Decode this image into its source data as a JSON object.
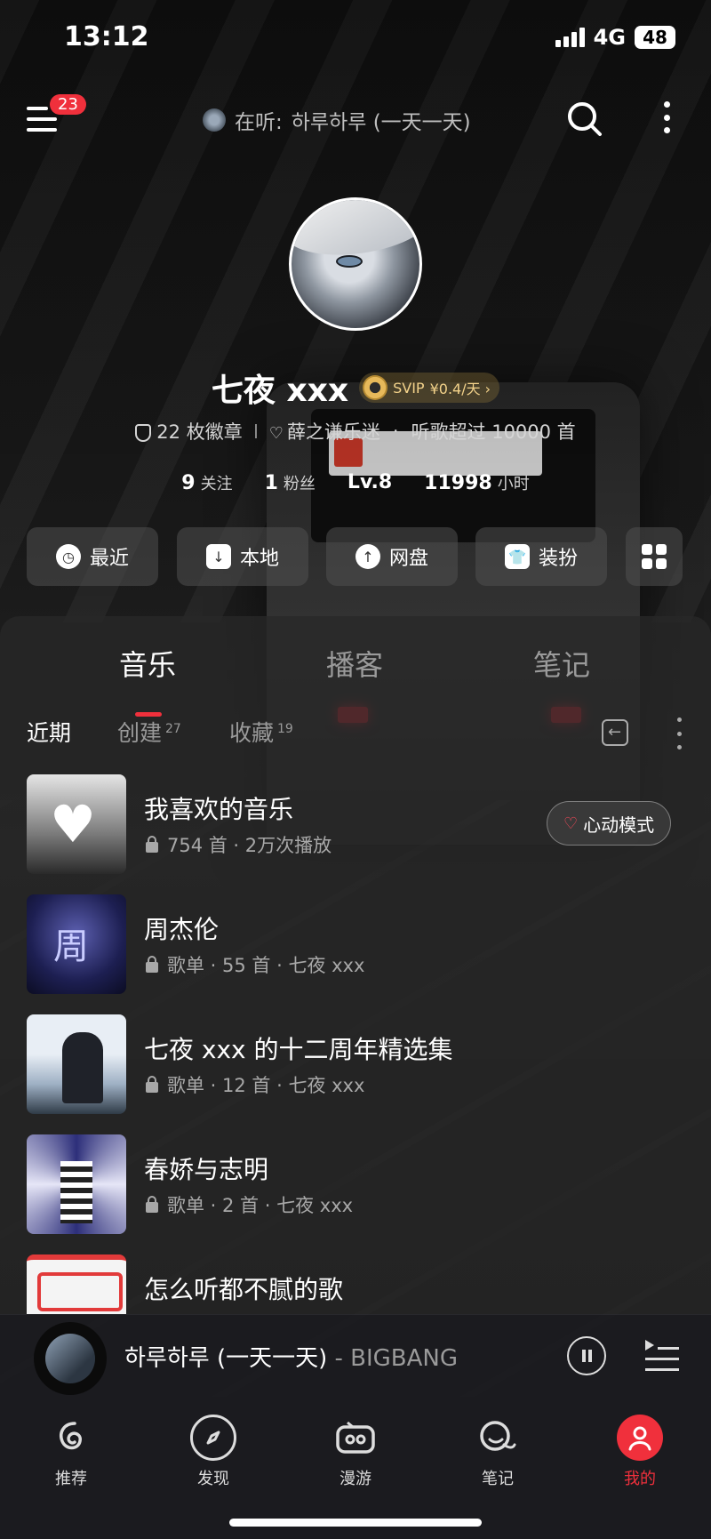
{
  "status": {
    "time": "13:12",
    "network": "4G",
    "battery": "48"
  },
  "topbar": {
    "menu_badge": "23",
    "now_playing_prefix": "在听:",
    "now_playing_song": "하루하루 (一天一天)",
    "icons": [
      "menu-icon",
      "search-icon",
      "more-vertical-icon"
    ]
  },
  "profile": {
    "username": "七夜 xxx",
    "svip_label": "SVIP",
    "svip_price": "¥0.4/天 ›",
    "badges": "22 枚徽章",
    "fan_label": "薛之谦乐迷",
    "listen_label": "听歌超过 10000 首",
    "stats": [
      {
        "num": "9",
        "unit": "关注"
      },
      {
        "num": "1",
        "unit": "粉丝"
      },
      {
        "num": "Lv.8",
        "unit": ""
      },
      {
        "num": "11998",
        "unit": "小时"
      }
    ]
  },
  "quick_actions": [
    {
      "label": "最近",
      "icon": "clock-icon"
    },
    {
      "label": "本地",
      "icon": "download-icon"
    },
    {
      "label": "网盘",
      "icon": "cloud-upload-icon"
    },
    {
      "label": "装扮",
      "icon": "shirt-icon"
    }
  ],
  "tabs": [
    "音乐",
    "播客",
    "笔记"
  ],
  "subtabs": [
    {
      "label": "近期",
      "count": ""
    },
    {
      "label": "创建",
      "count": "27"
    },
    {
      "label": "收藏",
      "count": "19"
    }
  ],
  "playlists": [
    {
      "title": "我喜欢的音乐",
      "subtitle": "754 首 · 2万次播放",
      "action": "心动模式"
    },
    {
      "title": "周杰伦",
      "subtitle": "歌单 · 55 首 · 七夜 xxx"
    },
    {
      "title": "七夜 xxx 的十二周年精选集",
      "subtitle": "歌单 · 12 首 · 七夜 xxx"
    },
    {
      "title": "春娇与志明",
      "subtitle": "歌单 · 2 首 · 七夜 xxx"
    },
    {
      "title": "怎么听都不腻的歌",
      "subtitle": ""
    }
  ],
  "player": {
    "song": "하루하루 (一天一天)",
    "artist": " - BIGBANG"
  },
  "bottom_nav": [
    {
      "label": "推荐",
      "icon": "netease-logo-icon"
    },
    {
      "label": "发现",
      "icon": "compass-icon"
    },
    {
      "label": "漫游",
      "icon": "radio-icon"
    },
    {
      "label": "笔记",
      "icon": "chat-bubble-icon"
    },
    {
      "label": "我的",
      "icon": "user-vip-icon"
    }
  ],
  "colors": {
    "accent": "#f0303c",
    "svip_gold": "#f3d28a"
  }
}
